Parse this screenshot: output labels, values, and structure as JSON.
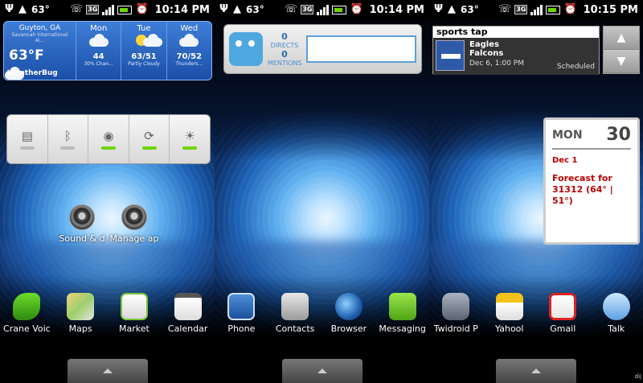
{
  "status_bars": [
    {
      "temp": "63°",
      "time": "10:14 PM",
      "net": "3G"
    },
    {
      "temp": "63°",
      "time": "10:14 PM",
      "net": "3G"
    },
    {
      "temp": "63°",
      "time": "10:15 PM",
      "net": "3G"
    }
  ],
  "screen1": {
    "weather": {
      "city": "Guyton, GA",
      "station": "Savannah International Ai...",
      "current_temp": "63°F",
      "brand": "WeatherBug",
      "days": [
        {
          "name": "Mon",
          "temp": "44",
          "cond": "30% Chan..."
        },
        {
          "name": "Tue",
          "temp": "63/51",
          "cond": "Partly Cloudy"
        },
        {
          "name": "Wed",
          "temp": "70/52",
          "cond": "Thunders..."
        }
      ]
    },
    "power_control": [
      "wifi",
      "bluetooth",
      "gps",
      "sync",
      "brightness"
    ],
    "shortcuts": [
      {
        "label": "Sound & d"
      },
      {
        "label": "Manage ap"
      }
    ],
    "dock": [
      {
        "label": "Crane Voic"
      },
      {
        "label": "Maps"
      },
      {
        "label": "Market"
      },
      {
        "label": "Calendar"
      }
    ]
  },
  "screen2": {
    "twidroid": {
      "directs_count": "0",
      "directs_label": "DIRECTS",
      "mentions_count": "0",
      "mentions_label": "MENTIONS"
    },
    "dock": [
      {
        "label": "Phone"
      },
      {
        "label": "Contacts"
      },
      {
        "label": "Browser"
      },
      {
        "label": "Messaging"
      }
    ]
  },
  "screen3": {
    "sports": {
      "brand": "sports tap",
      "team1": "Eagles",
      "team2": "Falcons",
      "date": "Dec 6, 1:00 PM",
      "status": "Scheduled"
    },
    "calendar": {
      "dow": "MON",
      "dom": "30",
      "date": "Dec 1",
      "event": "Forecast for 31312 (64° | 51°)"
    },
    "dock": [
      {
        "label": "Twidroid P"
      },
      {
        "label": "Yahool"
      },
      {
        "label": "Gmail"
      },
      {
        "label": "Talk"
      }
    ],
    "corner_text": "dij"
  },
  "colors": {
    "accent_green": "#6fd400",
    "weather_blue": "#2a62c0"
  }
}
